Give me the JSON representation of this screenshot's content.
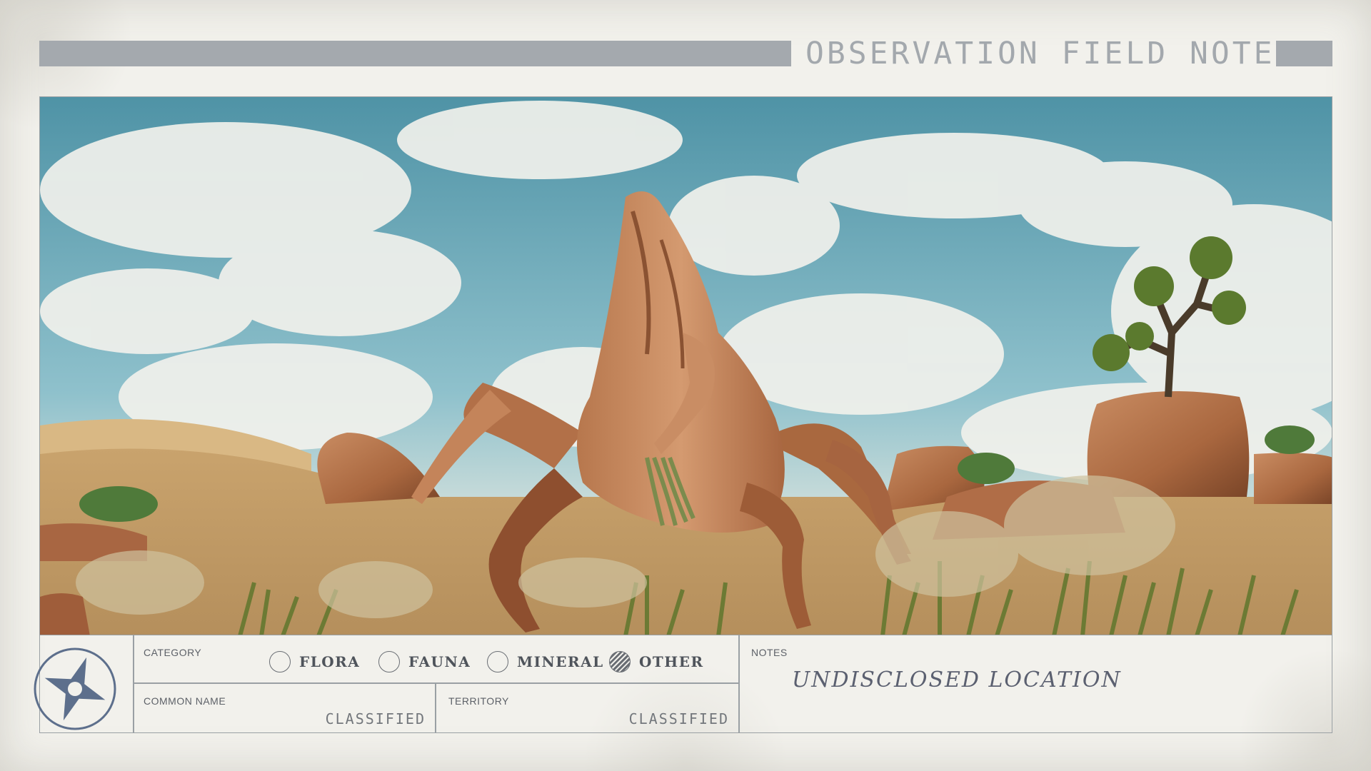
{
  "header": {
    "title": "OBSERVATION FIELD NOTES"
  },
  "photo": {
    "subject": "creature-in-desert",
    "icon": "photo"
  },
  "category": {
    "label": "CATEGORY",
    "options": [
      {
        "label": "FLORA",
        "selected": false
      },
      {
        "label": "FAUNA",
        "selected": false
      },
      {
        "label": "MINERAL",
        "selected": false
      },
      {
        "label": "OTHER",
        "selected": true
      }
    ]
  },
  "common_name": {
    "label": "COMMON NAME",
    "value": "CLASSIFIED"
  },
  "territory": {
    "label": "TERRITORY",
    "value": "CLASSIFIED"
  },
  "notes": {
    "label": "NOTES",
    "value": "UNDISCLOSED LOCATION"
  },
  "colors": {
    "paper": "#f2f1ec",
    "rule": "#9aa0a4",
    "header_bar": "#a4a9ae",
    "ink": "#5d6168",
    "emblem": "#5d6f8c"
  }
}
